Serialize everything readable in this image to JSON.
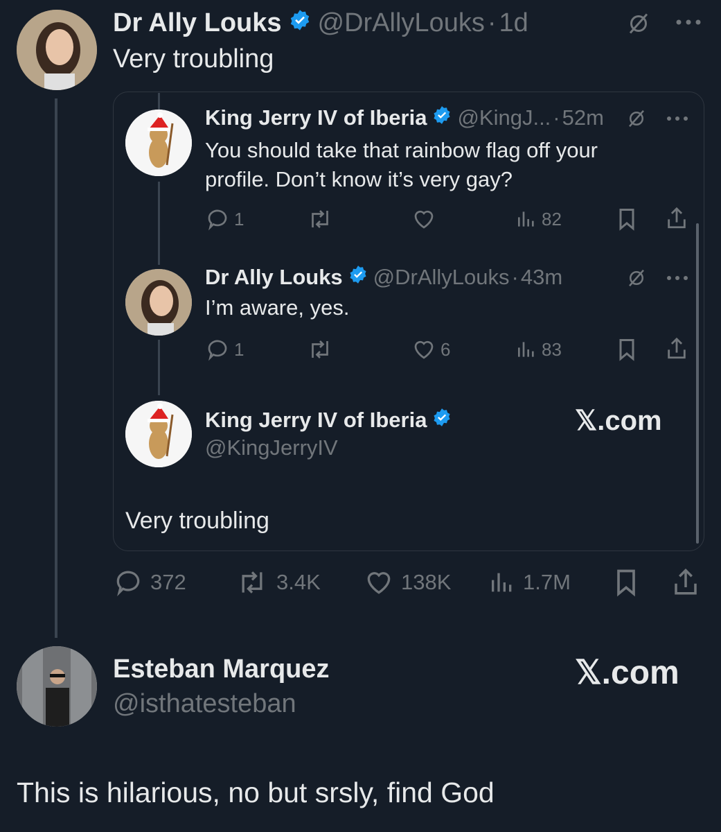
{
  "main_tweet": {
    "author_name": "Dr Ally Louks",
    "handle": "@DrAllyLouks",
    "time": "1d",
    "text": "Very troubling",
    "stats": {
      "replies": "372",
      "reposts": "3.4K",
      "likes": "138K",
      "views": "1.7M"
    }
  },
  "quote": {
    "tweet1": {
      "author_name": "King Jerry IV of Iberia",
      "handle": "@KingJ...",
      "time": "52m",
      "text_line1": "You should take that rainbow flag off your",
      "text_line2": "profile. Don’t know it’s very gay?",
      "stats": {
        "replies": "1",
        "reposts": "",
        "likes": "",
        "views": "82"
      }
    },
    "tweet2": {
      "author_name": "Dr Ally Louks",
      "handle": "@DrAllyLouks",
      "time": "43m",
      "text": "I’m aware, yes.",
      "stats": {
        "replies": "1",
        "reposts": "",
        "likes": "6",
        "views": "83"
      }
    },
    "tweet3": {
      "author_name": "King Jerry IV of Iberia",
      "handle": "@KingJerryIV",
      "brand": "𝕏.com"
    },
    "footer_text": "Very troubling"
  },
  "reply": {
    "author_name": "Esteban Marquez",
    "handle": "@isthatesteban",
    "brand": "𝕏.com",
    "text": "This is hilarious, no but srsly, find God"
  },
  "colors": {
    "background": "#151d28",
    "verified": "#1d9bf0",
    "muted": "#71767b",
    "text": "#e7e9ea"
  },
  "icons": [
    "verified-badge-icon",
    "grok-icon",
    "more-icon",
    "reply-icon",
    "repost-icon",
    "like-icon",
    "views-icon",
    "bookmark-icon",
    "share-icon"
  ]
}
